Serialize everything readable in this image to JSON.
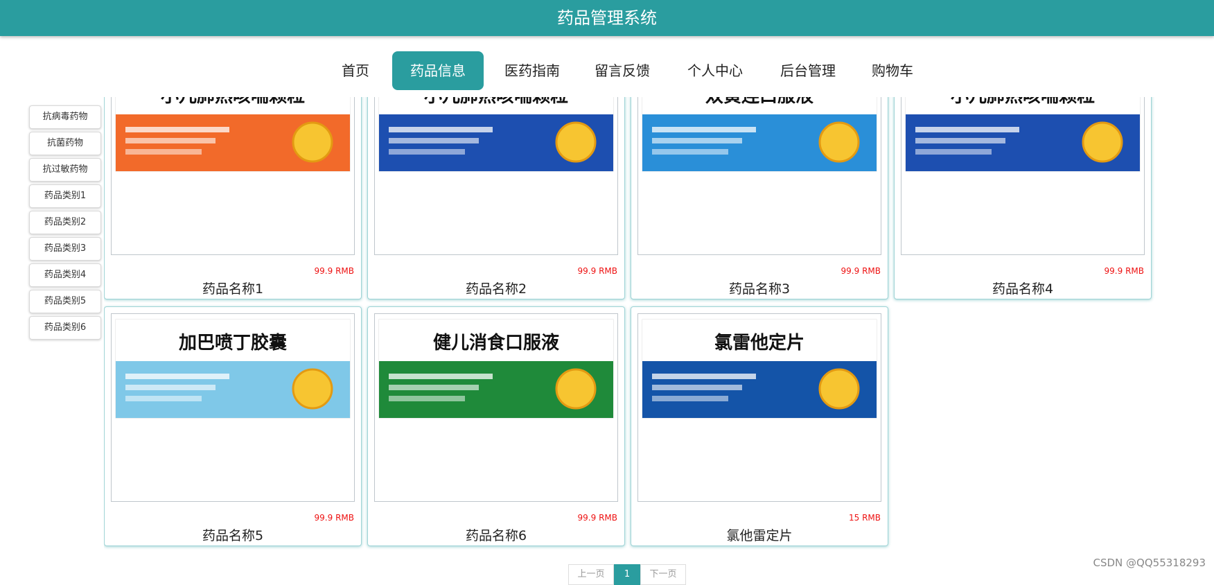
{
  "header": {
    "title": "药品管理系统"
  },
  "nav": [
    {
      "label": "首页",
      "active": false
    },
    {
      "label": "药品信息",
      "active": true
    },
    {
      "label": "医药指南",
      "active": false
    },
    {
      "label": "留言反馈",
      "active": false
    },
    {
      "label": "个人中心",
      "active": false
    },
    {
      "label": "后台管理",
      "active": false
    },
    {
      "label": "购物车",
      "active": false
    }
  ],
  "categories": [
    "抗病毒药物",
    "抗菌药物",
    "抗过敏药物",
    "药品类别1",
    "药品类别2",
    "药品类别3",
    "药品类别4",
    "药品类别5",
    "药品类别6"
  ],
  "products": [
    {
      "name": "药品名称1",
      "price": "99.9 RMB",
      "box_text": "小儿肺热咳喘颗粒",
      "box_color": "#f26a2a"
    },
    {
      "name": "药品名称2",
      "price": "99.9 RMB",
      "box_text": "小儿肺热咳喘颗粒",
      "box_color": "#1d4fb0"
    },
    {
      "name": "药品名称3",
      "price": "99.9 RMB",
      "box_text": "双黄连口服液",
      "box_color": "#2a8fd8"
    },
    {
      "name": "药品名称4",
      "price": "99.9 RMB",
      "box_text": "小儿肺热咳喘颗粒",
      "box_color": "#1d4fb0"
    },
    {
      "name": "药品名称5",
      "price": "99.9 RMB",
      "box_text": "加巴喷丁胶囊",
      "box_color": "#7fc8e8"
    },
    {
      "name": "药品名称6",
      "price": "99.9 RMB",
      "box_text": "健儿消食口服液",
      "box_color": "#1f8a3a"
    },
    {
      "name": "氯他雷定片",
      "price": "15 RMB",
      "box_text": "氯雷他定片",
      "box_color": "#1454a8"
    }
  ],
  "pager": {
    "prev": "上一页",
    "current": "1",
    "next": "下一页"
  },
  "watermark": "CSDN @QQ55318293"
}
